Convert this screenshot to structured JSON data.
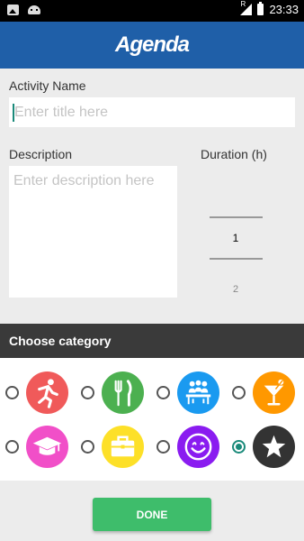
{
  "status_bar": {
    "time": "23:33",
    "signal_label": "R"
  },
  "app_bar": {
    "title": "Agenda"
  },
  "form": {
    "activity_name_label": "Activity Name",
    "title_placeholder": "Enter title here",
    "description_label": "Description",
    "description_placeholder": "Enter description here",
    "duration_label": "Duration (h)",
    "duration_selected": "1",
    "duration_next": "2"
  },
  "category_header": "Choose category",
  "categories": [
    {
      "icon": "running-person-icon",
      "color": "#f05a5a",
      "selected": false
    },
    {
      "icon": "fork-knife-icon",
      "color": "#4cb050",
      "selected": false
    },
    {
      "icon": "meeting-people-icon",
      "color": "#1a9af0",
      "selected": false
    },
    {
      "icon": "cocktail-icon",
      "color": "#ff9800",
      "selected": false
    },
    {
      "icon": "graduation-cap-icon",
      "color": "#f14fc8",
      "selected": false
    },
    {
      "icon": "briefcase-icon",
      "color": "#fde028",
      "selected": false
    },
    {
      "icon": "smiley-icon",
      "color": "#8a1cf0",
      "selected": false
    },
    {
      "icon": "star-icon",
      "color": "#333333",
      "selected": true
    }
  ],
  "done_button": "DONE"
}
